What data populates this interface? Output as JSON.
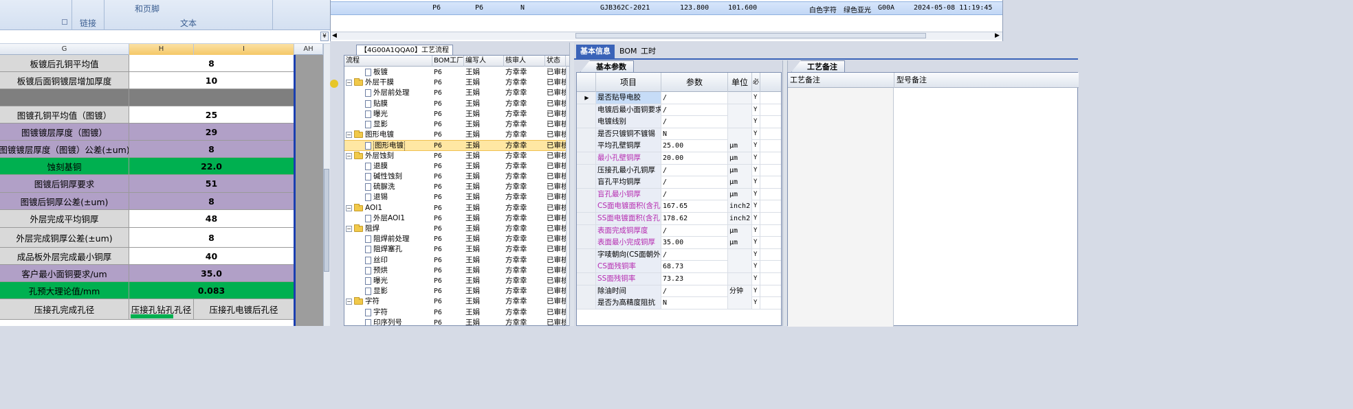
{
  "ribbon": {
    "groups": [
      {
        "label": "链接"
      },
      {
        "label": "文本",
        "line1": "和页脚"
      }
    ]
  },
  "spreadsheet": {
    "col_headers": [
      "G",
      "H",
      "I",
      "AH"
    ],
    "rows": [
      {
        "label": "板镀后孔铜平均值",
        "value": "8",
        "color": "#d9d9d9"
      },
      {
        "label": "板镀后面铜镀层增加厚度",
        "value": "10",
        "color": "#d9d9d9"
      },
      {
        "label": "",
        "value": "",
        "color": "#7f7f7f"
      },
      {
        "label": "图镀孔铜平均值（图镀）",
        "value": "25",
        "color": "#d9d9d9"
      },
      {
        "label": "图镀镀层厚度（图镀）",
        "value": "29",
        "color": "#b1a0c7"
      },
      {
        "label": "图镀镀层厚度（图镀）公差(±um)",
        "value": "8",
        "color": "#b1a0c7"
      },
      {
        "label": "蚀刻基铜",
        "value": "22.0",
        "color": "#00b050"
      },
      {
        "label": "图镀后铜厚要求",
        "value": "51",
        "color": "#b1a0c7"
      },
      {
        "label": "图镀后铜厚公差(±um)",
        "value": "8",
        "color": "#b1a0c7"
      },
      {
        "label": "外层完成平均铜厚",
        "value": "48",
        "color": "#d9d9d9"
      },
      {
        "label": "外层完成铜厚公差(±um)",
        "value": "8",
        "color": "#d9d9d9"
      },
      {
        "label": "成品板外层完成最小铜厚",
        "value": "40",
        "color": "#d9d9d9"
      },
      {
        "label": "客户最小面铜要求/um",
        "value": "35.0",
        "color": "#b1a0c7"
      },
      {
        "label": "孔预大理论值/mm",
        "value": "0.083",
        "color": "#00b050"
      }
    ],
    "last_row": {
      "label": "压接孔完成孔径",
      "h": "压接孔钻孔孔径",
      "i": "压接孔电镀后孔径"
    }
  },
  "top_record": {
    "values": [
      "P6",
      "P6",
      "N",
      "GJB362C-2021",
      "123.800",
      "101.600",
      "白色字符",
      "绿色亚光",
      "G00A",
      "2024-05-08 11:19:45"
    ]
  },
  "process": {
    "tab_title": "【4G00A1QQA0】工艺流程",
    "headers": [
      "流程",
      "BOM工厂",
      "编写人",
      "核审人",
      "状态"
    ],
    "rows": [
      {
        "name": "板镀",
        "level": 2,
        "type": "doc",
        "factory": "P6",
        "writer": "王娟",
        "reviewer": "方幸幸",
        "status": "已审核"
      },
      {
        "name": "外层干膜",
        "level": 1,
        "type": "folder",
        "factory": "P6",
        "writer": "王娟",
        "reviewer": "方幸幸",
        "status": "已审核"
      },
      {
        "name": "外层前处理",
        "level": 2,
        "type": "doc",
        "factory": "P6",
        "writer": "王娟",
        "reviewer": "方幸幸",
        "status": "已审核"
      },
      {
        "name": "贴膜",
        "level": 2,
        "type": "doc",
        "factory": "P6",
        "writer": "王娟",
        "reviewer": "方幸幸",
        "status": "已审核"
      },
      {
        "name": "曝光",
        "level": 2,
        "type": "doc",
        "factory": "P6",
        "writer": "王娟",
        "reviewer": "方幸幸",
        "status": "已审核"
      },
      {
        "name": "显影",
        "level": 2,
        "type": "doc",
        "factory": "P6",
        "writer": "王娟",
        "reviewer": "方幸幸",
        "status": "已审核"
      },
      {
        "name": "图形电镀",
        "level": 1,
        "type": "folder",
        "factory": "P6",
        "writer": "王娟",
        "reviewer": "方幸幸",
        "status": "已审核"
      },
      {
        "name": "图形电镀",
        "level": 2,
        "type": "doc",
        "factory": "P6",
        "writer": "王娟",
        "reviewer": "方幸幸",
        "status": "已审核",
        "selected": true
      },
      {
        "name": "外层蚀刻",
        "level": 1,
        "type": "folder",
        "factory": "P6",
        "writer": "王娟",
        "reviewer": "方幸幸",
        "status": "已审核"
      },
      {
        "name": "退膜",
        "level": 2,
        "type": "doc",
        "factory": "P6",
        "writer": "王娟",
        "reviewer": "方幸幸",
        "status": "已审核"
      },
      {
        "name": "碱性蚀刻",
        "level": 2,
        "type": "doc",
        "factory": "P6",
        "writer": "王娟",
        "reviewer": "方幸幸",
        "status": "已审核"
      },
      {
        "name": "硫脲洗",
        "level": 2,
        "type": "doc",
        "factory": "P6",
        "writer": "王娟",
        "reviewer": "方幸幸",
        "status": "已审核"
      },
      {
        "name": "退锡",
        "level": 2,
        "type": "doc",
        "factory": "P6",
        "writer": "王娟",
        "reviewer": "方幸幸",
        "status": "已审核"
      },
      {
        "name": "AOI1",
        "level": 1,
        "type": "folder",
        "factory": "P6",
        "writer": "王娟",
        "reviewer": "方幸幸",
        "status": "已审核"
      },
      {
        "name": "外层AOI1",
        "level": 2,
        "type": "doc",
        "factory": "P6",
        "writer": "王娟",
        "reviewer": "方幸幸",
        "status": "已审核"
      },
      {
        "name": "阻焊",
        "level": 1,
        "type": "folder",
        "factory": "P6",
        "writer": "王娟",
        "reviewer": "方幸幸",
        "status": "已审核"
      },
      {
        "name": "阻焊前处理",
        "level": 2,
        "type": "doc",
        "factory": "P6",
        "writer": "王娟",
        "reviewer": "方幸幸",
        "status": "已审核"
      },
      {
        "name": "阻焊塞孔",
        "level": 2,
        "type": "doc",
        "factory": "P6",
        "writer": "王娟",
        "reviewer": "方幸幸",
        "status": "已审核"
      },
      {
        "name": "丝印",
        "level": 2,
        "type": "doc",
        "factory": "P6",
        "writer": "王娟",
        "reviewer": "方幸幸",
        "status": "已审核"
      },
      {
        "name": "预烘",
        "level": 2,
        "type": "doc",
        "factory": "P6",
        "writer": "王娟",
        "reviewer": "方幸幸",
        "status": "已审核"
      },
      {
        "name": "曝光",
        "level": 2,
        "type": "doc",
        "factory": "P6",
        "writer": "王娟",
        "reviewer": "方幸幸",
        "status": "已审核"
      },
      {
        "name": "显影",
        "level": 2,
        "type": "doc",
        "factory": "P6",
        "writer": "王娟",
        "reviewer": "方幸幸",
        "status": "已审核"
      },
      {
        "name": "字符",
        "level": 1,
        "type": "folder",
        "factory": "P6",
        "writer": "王娟",
        "reviewer": "方幸幸",
        "status": "已审核"
      },
      {
        "name": "字符",
        "level": 2,
        "type": "doc",
        "factory": "P6",
        "writer": "王娟",
        "reviewer": "方幸幸",
        "status": "已审核"
      },
      {
        "name": "印序列号",
        "level": 2,
        "type": "doc",
        "factory": "P6",
        "writer": "王娟",
        "reviewer": "方幸幸",
        "status": "已审核"
      }
    ]
  },
  "info": {
    "tabs": [
      "基本信息",
      "BOM",
      "工时"
    ],
    "params_tab": "基本参数",
    "params_headers": [
      "项目",
      "参数",
      "单位",
      "必"
    ],
    "params": [
      {
        "item": "是否贴导电胶",
        "value": "/",
        "unit": "",
        "flag": "Y",
        "magenta": false,
        "selected": true
      },
      {
        "item": "电镀后最小面铜要求",
        "value": "/",
        "unit": "",
        "flag": "Y",
        "magenta": false
      },
      {
        "item": "电镀线别",
        "value": "/",
        "unit": "",
        "flag": "Y",
        "magenta": false
      },
      {
        "item": "是否只镀铜不镀锡",
        "value": "N",
        "unit": "",
        "flag": "Y",
        "magenta": false
      },
      {
        "item": "平均孔壁铜厚",
        "value": "25.00",
        "unit": "μm",
        "flag": "Y",
        "magenta": false
      },
      {
        "item": "最小孔壁铜厚",
        "value": "20.00",
        "unit": "μm",
        "flag": "Y",
        "magenta": true
      },
      {
        "item": "压接孔最小孔铜厚",
        "value": "/",
        "unit": "μm",
        "flag": "Y",
        "magenta": false
      },
      {
        "item": "盲孔平均铜厚",
        "value": "/",
        "unit": "μm",
        "flag": "Y",
        "magenta": false
      },
      {
        "item": "盲孔最小铜厚",
        "value": "/",
        "unit": "μm",
        "flag": "Y",
        "magenta": true
      },
      {
        "item": "CS面电镀面积(含孔)",
        "value": "167.65",
        "unit": "inch2",
        "flag": "Y",
        "magenta": true
      },
      {
        "item": "SS面电镀面积(含孔)",
        "value": "178.62",
        "unit": "inch2",
        "flag": "Y",
        "magenta": true
      },
      {
        "item": "表面完成铜厚度",
        "value": "/",
        "unit": "μm",
        "flag": "Y",
        "magenta": true
      },
      {
        "item": "表面最小完成铜厚",
        "value": "35.00",
        "unit": "μm",
        "flag": "Y",
        "magenta": true
      },
      {
        "item": "字唛朝向(CS面朝外)",
        "value": "/",
        "unit": "",
        "flag": "Y",
        "magenta": false
      },
      {
        "item": "CS面残铜率",
        "value": "68.73",
        "unit": "",
        "flag": "Y",
        "magenta": true
      },
      {
        "item": "SS面残铜率",
        "value": "73.23",
        "unit": "",
        "flag": "Y",
        "magenta": true
      },
      {
        "item": "除油时间",
        "value": "/",
        "unit": "分钟",
        "flag": "Y",
        "magenta": false
      },
      {
        "item": "是否为高精度阻抗",
        "value": "N",
        "unit": "",
        "flag": "Y",
        "magenta": false
      }
    ],
    "remarks_tab": "工艺备注",
    "remarks_headers": [
      "工艺备注",
      "型号备注"
    ]
  }
}
